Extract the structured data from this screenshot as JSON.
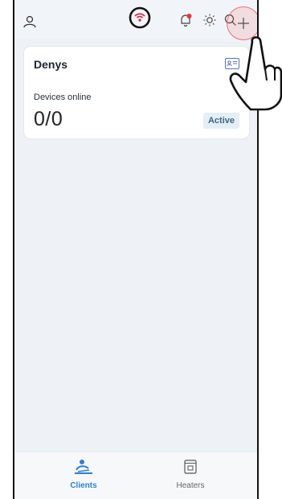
{
  "header": {
    "icons": [
      "user-icon",
      "wifi-signal-icon",
      "notification-bell-icon",
      "brightness-icon",
      "search-icon",
      "add-icon"
    ],
    "colors": {
      "wifi": "#d8223a",
      "notification_dot": "#e53935"
    }
  },
  "card": {
    "title": "Denys",
    "devices_label": "Devices online",
    "devices_value": "0/0",
    "status": "Active"
  },
  "bottom_nav": {
    "items": [
      {
        "label": "Clients",
        "icon": "clients-icon",
        "active": true
      },
      {
        "label": "Heaters",
        "icon": "heater-icon",
        "active": false
      }
    ],
    "colors": {
      "active": "#2f7fd0",
      "inactive": "#666666"
    }
  }
}
